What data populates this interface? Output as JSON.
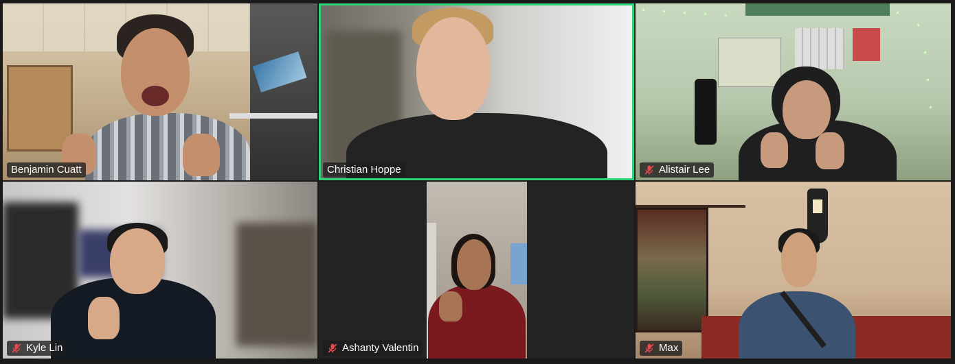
{
  "meeting": {
    "participants": [
      {
        "name": "Benjamin Cuatt",
        "muted": false,
        "active_speaker": false
      },
      {
        "name": "Christian Hoppe",
        "muted": false,
        "active_speaker": true
      },
      {
        "name": "Alistair Lee",
        "muted": true,
        "active_speaker": false
      },
      {
        "name": "Kyle Lin",
        "muted": true,
        "active_speaker": false
      },
      {
        "name": "Ashanty Valentin",
        "muted": true,
        "active_speaker": false
      },
      {
        "name": "Max",
        "muted": true,
        "active_speaker": false
      }
    ]
  },
  "colors": {
    "background": "#1a1a1a",
    "active_speaker_border": "#2fd17b",
    "mute_icon": "#e5484d",
    "name_tag_bg": "#1e1e1e"
  },
  "icons": {
    "muted": "mic-muted-icon"
  }
}
